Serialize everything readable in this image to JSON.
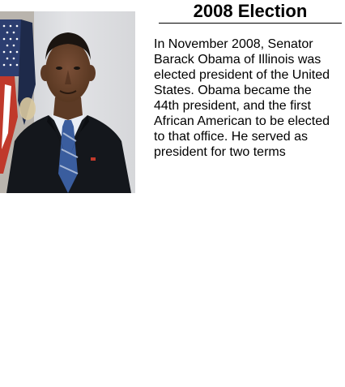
{
  "article": {
    "title": "2008 Election",
    "body": "In November 2008, Senator\nBarack Obama of Illinois was\nelected president of the United\nStates. Obama became the\n44th president, and the first\nAfrican American to be elected\nto that office. He served as\npresident for two terms"
  },
  "photo": {
    "subject": "portrait-photo",
    "colors": {
      "backdrop": "#dcdcdc",
      "suit": "#14171c",
      "shirt": "#e8edf5",
      "tie": "#3a5d9e",
      "skin": "#6b4530",
      "hair": "#1a1410",
      "flag_red": "#c0392b",
      "flag_blue": "#2c3e70"
    }
  }
}
